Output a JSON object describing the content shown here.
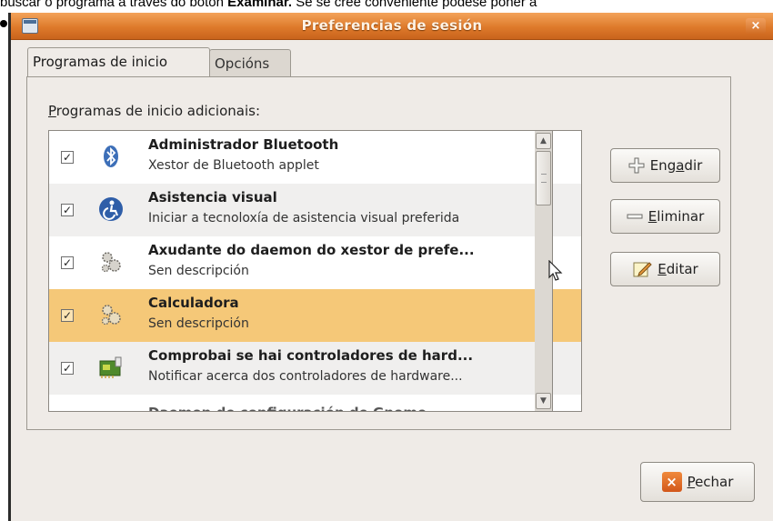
{
  "doc": {
    "pre": "buscar o programa a través do botón ",
    "bold": "Examinar.",
    "post": " Se se cree conveniente podese poñer a"
  },
  "window": {
    "title": "Preferencias de sesión",
    "close_glyph": "×"
  },
  "tabs": [
    {
      "label": "Programas de inicio"
    },
    {
      "label": "Opcións"
    }
  ],
  "section_label": "Programas de inicio adicionais:",
  "section_label_mnemonic": "P",
  "section_label_rest": "rogramas de inicio adicionais:",
  "startup_list": [
    {
      "title": "Administrador Bluetooth",
      "description": "Xestor de Bluetooth applet",
      "checked": true,
      "icon": "bluetooth-icon"
    },
    {
      "title": "Asistencia visual",
      "description": "Iniciar a tecnoloxía de asistencia visual preferida",
      "checked": true,
      "icon": "accessibility-icon"
    },
    {
      "title": "Axudante do daemon do xestor de prefe...",
      "description": "Sen descripción",
      "checked": true,
      "icon": "gears-icon"
    },
    {
      "title": "Calculadora",
      "description": "Sen descripción",
      "checked": true,
      "icon": "gears-icon",
      "selected": true
    },
    {
      "title": "Comprobai se hai controladores de hard...",
      "description": "Notificar acerca dos controladores de hardware...",
      "checked": true,
      "icon": "hardware-card-icon"
    },
    {
      "title": "Daemon de configuración de Gnome",
      "description": "",
      "checked": true,
      "icon": "gears-icon"
    }
  ],
  "check_glyph": "✓",
  "buttons": {
    "add": {
      "pre": "Eng",
      "mnemonic": "a",
      "post": "dir"
    },
    "remove": {
      "pre": "",
      "mnemonic": "E",
      "post": "liminar"
    },
    "edit": {
      "pre": "",
      "mnemonic": "E",
      "post": "ditar"
    },
    "close": {
      "pre": "",
      "mnemonic": "P",
      "post": "echar"
    }
  },
  "colors": {
    "titlebar": "#de7a2b",
    "selection": "#f5c878",
    "accent_orange": "#d2571a"
  }
}
